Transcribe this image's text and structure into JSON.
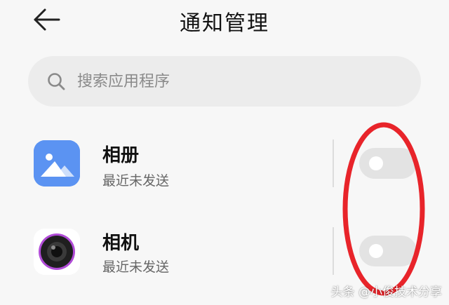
{
  "header": {
    "title": "通知管理",
    "back_icon": "arrow-left-icon"
  },
  "search": {
    "placeholder": "搜索应用程序",
    "value": "",
    "icon": "search-icon"
  },
  "apps": [
    {
      "name": "相册",
      "status": "最近未发送",
      "icon": "gallery-icon",
      "toggle_on": false
    },
    {
      "name": "相机",
      "status": "最近未发送",
      "icon": "camera-icon",
      "toggle_on": false
    }
  ],
  "colors": {
    "gallery_icon_bg": "#5b93f2",
    "annotation_circle": "#e8242a",
    "toggle_off": "#e3e3e3",
    "background": "#f7f7f7"
  },
  "watermark": "头条 @小俊技术分享"
}
